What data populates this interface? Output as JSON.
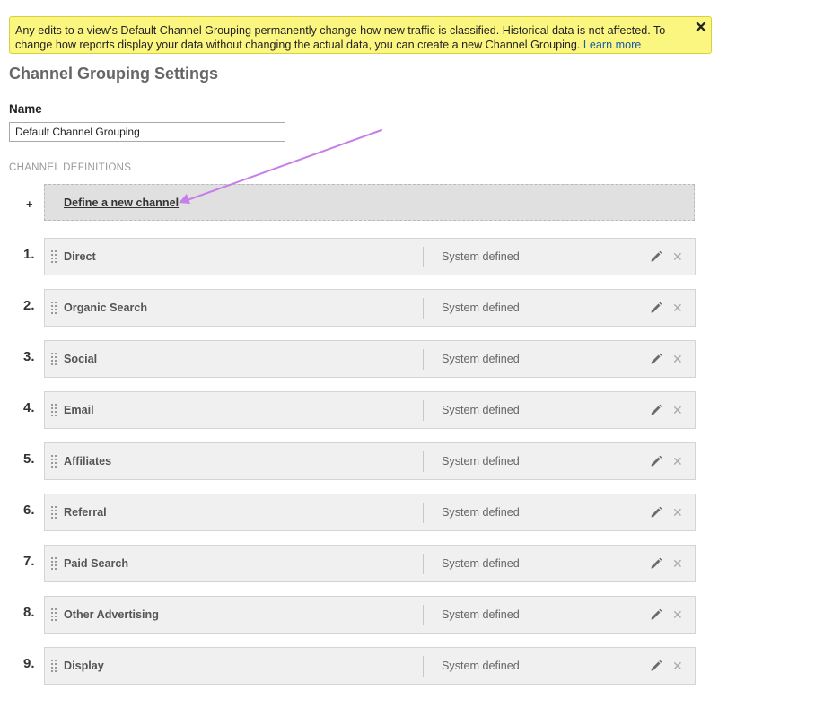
{
  "banner": {
    "text": "Any edits to a view’s Default Channel Grouping permanently change how new traffic is classified. Historical data is not affected. To change how reports display your data without changing the actual data, you can create a new Channel Grouping.",
    "link_label": "Learn more",
    "close_label": "✕",
    "color": "#fbf680"
  },
  "page": {
    "title": "Channel Grouping Settings"
  },
  "name_field": {
    "label": "Name",
    "value": "Default Channel Grouping"
  },
  "definitions": {
    "header": "CHANNEL DEFINITIONS",
    "add_symbol": "+",
    "define_label": "Define a new channel",
    "channels": [
      {
        "number": "1.",
        "name": "Direct",
        "type": "System defined"
      },
      {
        "number": "2.",
        "name": "Organic Search",
        "type": "System defined"
      },
      {
        "number": "3.",
        "name": "Social",
        "type": "System defined"
      },
      {
        "number": "4.",
        "name": "Email",
        "type": "System defined"
      },
      {
        "number": "5.",
        "name": "Affiliates",
        "type": "System defined"
      },
      {
        "number": "6.",
        "name": "Referral",
        "type": "System defined"
      },
      {
        "number": "7.",
        "name": "Paid Search",
        "type": "System defined"
      },
      {
        "number": "8.",
        "name": "Other Advertising",
        "type": "System defined"
      },
      {
        "number": "9.",
        "name": "Display",
        "type": "System defined"
      }
    ],
    "delete_symbol": "✕"
  },
  "icons": {
    "row_edit": "pencil-icon",
    "row_delete": "close-icon",
    "row_drag": "drag-handle-icon"
  },
  "annotation": {
    "color": "#c77ee8"
  }
}
